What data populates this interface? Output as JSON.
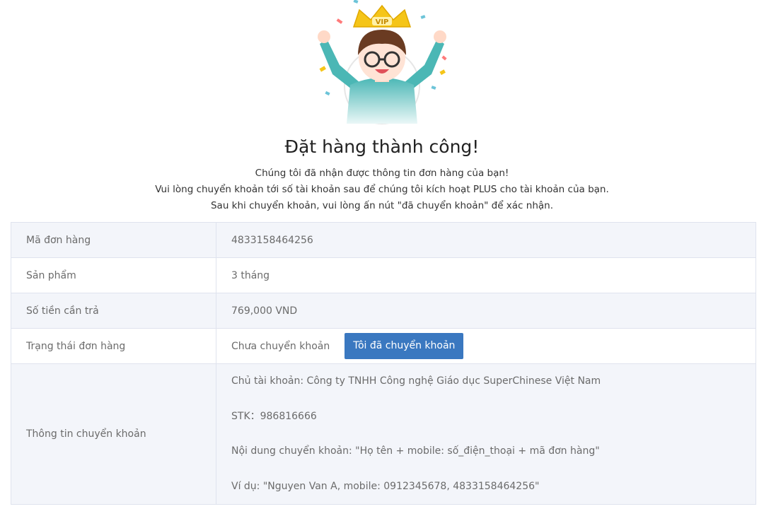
{
  "hero": {
    "crown_text": "VIP"
  },
  "title": "Đặt hàng thành công!",
  "messages": [
    "Chúng tôi đã nhận được thông tin đơn hàng của bạn!",
    "Vui lòng chuyển khoản tới số tài khoản sau để chúng tôi kích hoạt PLUS cho tài khoản của bạn.",
    "Sau khi chuyển khoản, vui lòng ấn nút \"đã chuyển khoản\" để xác nhận."
  ],
  "order": {
    "id_label": "Mã đơn hàng",
    "id_value": "4833158464256",
    "product_label": "Sản phẩm",
    "product_value": "3 tháng",
    "amount_label": "Số tiền cần trả",
    "amount_value": "769,000 VND",
    "status_label": "Trạng thái đơn hàng",
    "status_value": "Chưa chuyển khoản",
    "confirm_button": "Tôi đã chuyển khoản",
    "transfer_label": "Thông tin chuyển khoản",
    "transfer_lines": [
      "Chủ tài khoản: Công ty TNHH Công nghệ Giáo dục SuperChinese Việt Nam",
      "STK：986816666",
      "Nội dung chuyển khoản: \"Họ tên + mobile: số_điện_thoại + mã đơn hàng\"",
      "Ví dụ: \"Nguyen Van A, mobile: 0912345678, 4833158464256\""
    ]
  },
  "colors": {
    "button": "#3a78c0",
    "row_shade": "#f3f5fa",
    "border": "#dfe3ee",
    "crown": "#f5c518",
    "shirt": "#4bb7b5"
  }
}
